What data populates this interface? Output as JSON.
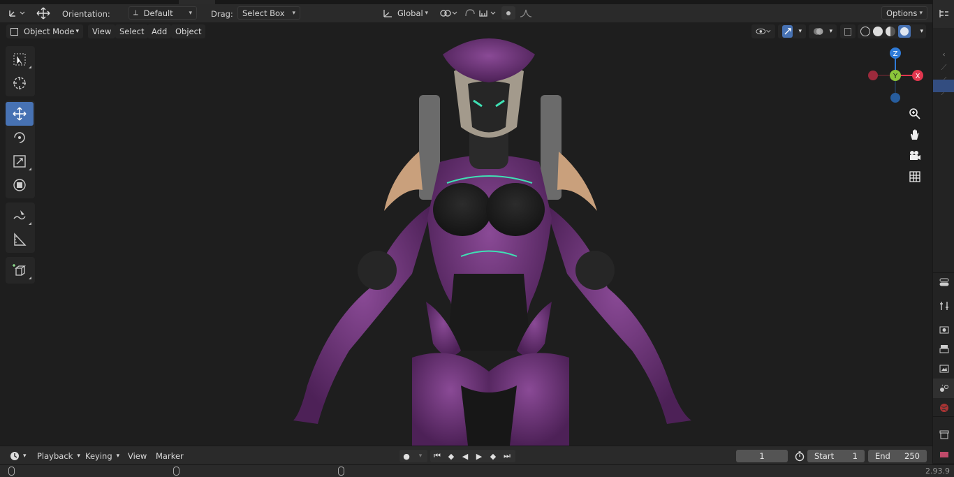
{
  "toolbar": {
    "orientation_label": "Orientation:",
    "orientation_value": "Default",
    "drag_label": "Drag:",
    "drag_value": "Select Box",
    "transform_space": "Global",
    "options_label": "Options"
  },
  "header": {
    "mode": "Object Mode",
    "menus": [
      "View",
      "Select",
      "Add",
      "Object"
    ]
  },
  "tools": [
    "select-box",
    "cursor",
    "move",
    "rotate",
    "scale",
    "transform",
    "annotate",
    "measure",
    "add-cube"
  ],
  "active_tool": "move",
  "gizmo": {
    "z": "Z",
    "y": "Y",
    "x": "X"
  },
  "timeline": {
    "menus": [
      "Playback",
      "Keying",
      "View",
      "Marker"
    ],
    "current_frame": "1",
    "start_label": "Start",
    "start_value": "1",
    "end_label": "End",
    "end_value": "250"
  },
  "status": {
    "version": "2.93.9"
  },
  "colors": {
    "accent": "#4772b3",
    "axis_x": "#e0364e",
    "axis_y": "#8bc53a",
    "axis_z": "#2f7bd8",
    "model_purple": "#7a3f86"
  }
}
